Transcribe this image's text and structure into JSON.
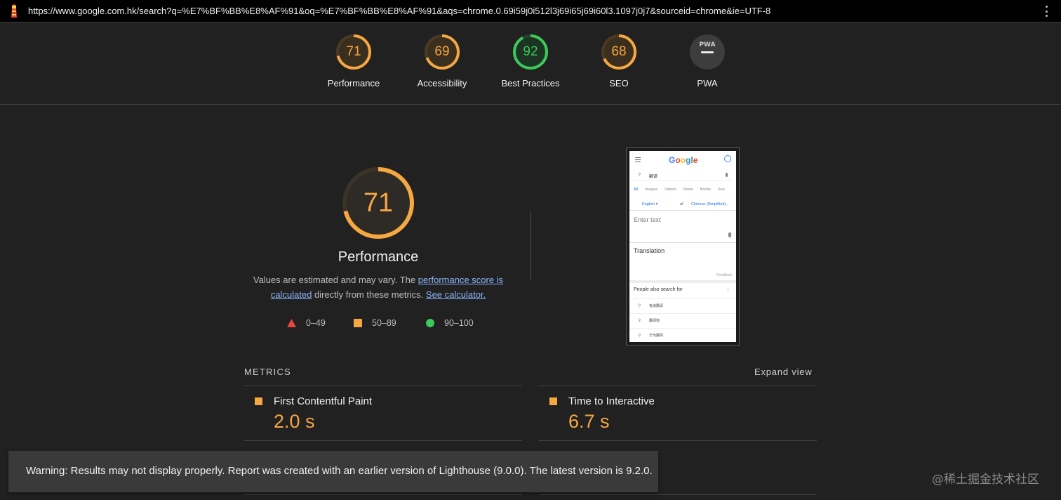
{
  "topbar": {
    "url": "https://www.google.com.hk/search?q=%E7%BF%BB%E8%AF%91&oq=%E7%BF%BB%E8%AF%91&aqs=chrome.0.69i59j0i512l3j69i65j69i60l3.1097j0j7&sourceid=chrome&ie=UTF-8",
    "logo_icon": "lighthouse-icon",
    "menu_icon": "kebab-menu-icon"
  },
  "colors": {
    "average": "#f5a742",
    "pass": "#3cc85b",
    "fail": "#e8453c",
    "pwa": "#d0d0d0"
  },
  "categories": [
    {
      "label": "Performance",
      "score": "71",
      "value": 71,
      "status": "average"
    },
    {
      "label": "Accessibility",
      "score": "69",
      "value": 69,
      "status": "average"
    },
    {
      "label": "Best Practices",
      "score": "92",
      "value": 92,
      "status": "pass"
    },
    {
      "label": "SEO",
      "score": "68",
      "value": 68,
      "status": "average"
    },
    {
      "label": "PWA",
      "score": "PWA",
      "value": null,
      "status": "pwa"
    }
  ],
  "performance": {
    "score": "71",
    "value": 71,
    "title": "Performance",
    "desc_prefix": "Values are estimated and may vary. The ",
    "link_score": "performance score is calculated",
    "desc_middle": " directly from these metrics. ",
    "link_calculator": "See calculator."
  },
  "legend": [
    {
      "range": "0–49",
      "shape": "triangle"
    },
    {
      "range": "50–89",
      "shape": "square"
    },
    {
      "range": "90–100",
      "shape": "circle"
    }
  ],
  "screenshot": {
    "logo": "Google",
    "query": "翻译",
    "tabs": [
      "All",
      "Images",
      "Videos",
      "News",
      "Books",
      "Sea"
    ],
    "lang_from": "English ▾",
    "lang_to": "Chinese (Simplified)...",
    "placeholder": "Enter text",
    "translation_label": "Translation",
    "feedback": "Feedback",
    "people_also": "People also search for",
    "suggestions": [
      "有道翻译",
      "翻译狗",
      "华为翻译"
    ]
  },
  "metrics": {
    "heading": "METRICS",
    "expand": "Expand view",
    "items": [
      {
        "name": "First Contentful Paint",
        "value": "2.0 s",
        "status": "average"
      },
      {
        "name": "Time to Interactive",
        "value": "6.7 s",
        "status": "average"
      }
    ]
  },
  "toast": {
    "text": "Warning: Results may not display properly. Report was created with an earlier version of Lighthouse (9.0.0). The latest version is 9.2.0."
  },
  "watermark": "@稀土掘金技术社区"
}
